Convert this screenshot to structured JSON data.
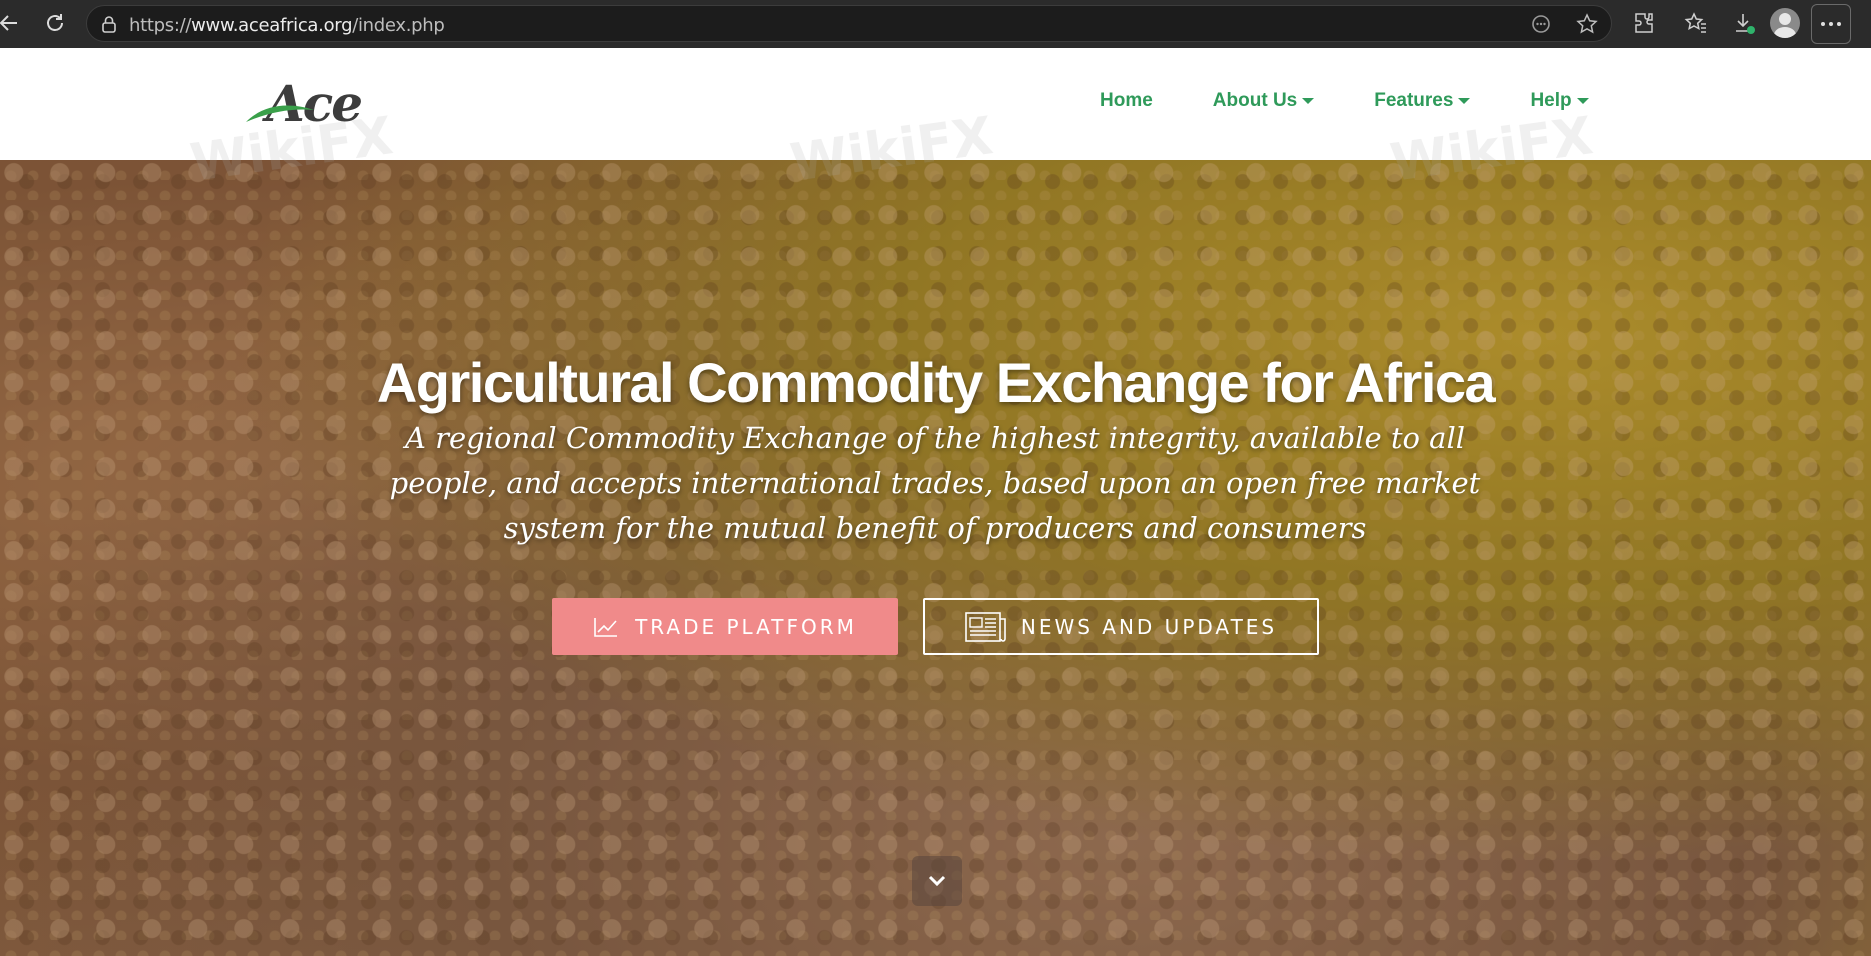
{
  "browser": {
    "url_prefix": "https://",
    "url_host": "www.aceafrica.org",
    "url_path": "/index.php"
  },
  "site": {
    "logo_text": "Ace",
    "nav": [
      {
        "label": "Home",
        "has_dropdown": false
      },
      {
        "label": "About Us",
        "has_dropdown": true
      },
      {
        "label": "Features",
        "has_dropdown": true
      },
      {
        "label": "Help",
        "has_dropdown": true
      }
    ],
    "accent_color": "#2f9a5a",
    "watermark_text": "WikiFX"
  },
  "hero": {
    "title": "Agricultural Commodity Exchange for Africa",
    "subtitle": "A regional Commodity Exchange of the highest integrity, available to all people, and accepts international trades, based upon an open free market system for the mutual benefit of producers and consumers",
    "trade_button": {
      "label": "TRADE PLATFORM",
      "icon": "chart-line-icon",
      "color": "#f08a8a"
    },
    "news_button": {
      "label": "NEWS AND UPDATES",
      "icon": "newspaper-icon"
    },
    "scroll_icon": "chevron-down-icon"
  }
}
